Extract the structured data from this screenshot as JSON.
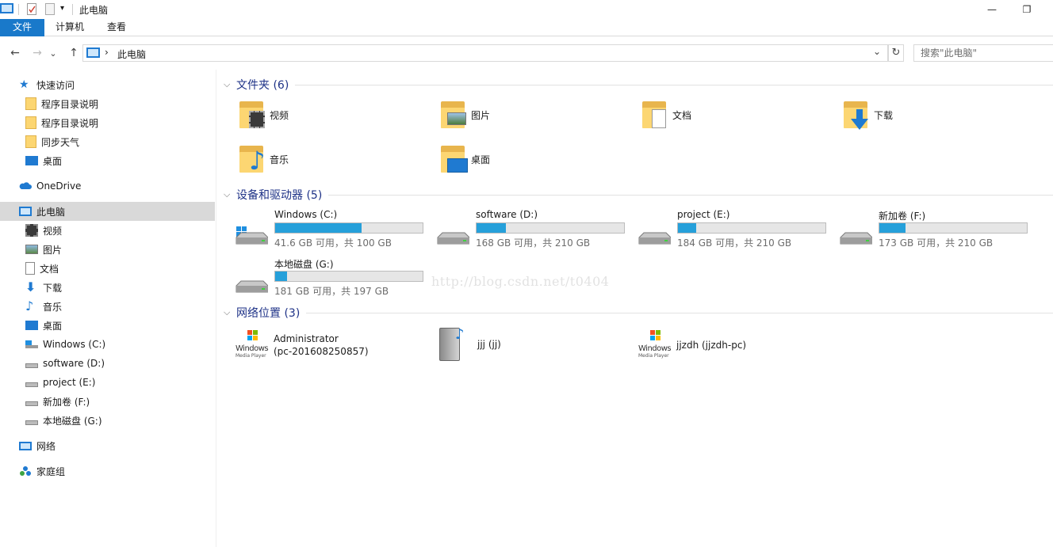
{
  "window": {
    "title": "此电脑",
    "quick_access_dropdown": "▾",
    "minimize": "—",
    "restore": "❐"
  },
  "ribbon": {
    "tabs": [
      "文件",
      "计算机",
      "查看"
    ]
  },
  "nav": {
    "back": "←",
    "forward": "→",
    "recent": "⌄",
    "up": "↑",
    "address_sep": "›",
    "address": "此电脑",
    "address_dropdown": "⌄",
    "refresh": "↻",
    "search_placeholder": "搜索\"此电脑\""
  },
  "sidebar": {
    "quick_access": "快速访问",
    "quick_items": [
      "程序目录说明",
      "程序目录说明",
      "同步天气",
      "桌面"
    ],
    "onedrive": "OneDrive",
    "this_pc": "此电脑",
    "pc_items": [
      "视频",
      "图片",
      "文档",
      "下载",
      "音乐",
      "桌面",
      "Windows (C:)",
      "software (D:)",
      "project (E:)",
      "新加卷 (F:)",
      "本地磁盘 (G:)"
    ],
    "network": "网络",
    "homegroup": "家庭组"
  },
  "main": {
    "groups": {
      "folders": "文件夹 (6)",
      "drives": "设备和驱动器 (5)",
      "network": "网络位置 (3)"
    },
    "collapse_glyph": "⌵",
    "folders": [
      "视频",
      "图片",
      "文档",
      "下载",
      "音乐",
      "桌面"
    ],
    "drives": [
      {
        "name": "Windows (C:)",
        "free": "41.6 GB 可用，共 100 GB",
        "used_fraction": 0.584
      },
      {
        "name": "software (D:)",
        "free": "168 GB 可用，共 210 GB",
        "used_fraction": 0.2
      },
      {
        "name": "project (E:)",
        "free": "184 GB 可用，共 210 GB",
        "used_fraction": 0.124
      },
      {
        "name": "新加卷 (F:)",
        "free": "173 GB 可用，共 210 GB",
        "used_fraction": 0.176
      },
      {
        "name": "本地磁盘 (G:)",
        "free": "181 GB 可用，共 197 GB",
        "used_fraction": 0.081
      }
    ],
    "network_locations": [
      {
        "name": "Administrator\n(pc-201608250857)",
        "icon_caption": [
          "Windows",
          "Media Player"
        ]
      },
      {
        "name": "jjj (jj)"
      },
      {
        "name": "jjzdh (jjzdh-pc)",
        "icon_caption": [
          "Windows",
          "Media Player"
        ]
      }
    ],
    "watermark": "http://blog.csdn.net/t0404"
  },
  "colors": {
    "accent": "#1979ca",
    "bar_fill": "#26a0da",
    "group_title": "#1e3287",
    "folder": "#fcd672"
  }
}
